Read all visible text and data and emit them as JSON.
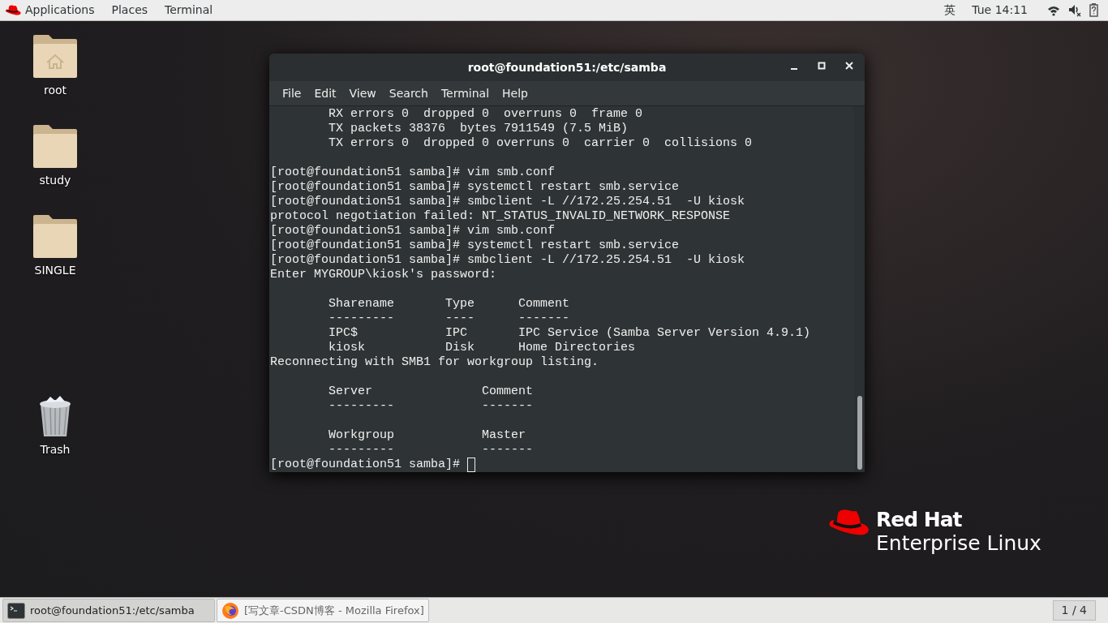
{
  "top_bar": {
    "menus": [
      "Applications",
      "Places",
      "Terminal"
    ],
    "input_method": "英",
    "clock": "Tue 14:11"
  },
  "desktop_icons": [
    {
      "label": "root",
      "kind": "home"
    },
    {
      "label": "study",
      "kind": "folder"
    },
    {
      "label": "SINGLE",
      "kind": "folder"
    },
    {
      "label": "Trash",
      "kind": "trash"
    }
  ],
  "terminal": {
    "title": "root@foundation51:/etc/samba",
    "menu": [
      "File",
      "Edit",
      "View",
      "Search",
      "Terminal",
      "Help"
    ],
    "blocks": [
      [
        "        RX errors 0  dropped 0  overruns 0  frame 0",
        "        TX packets 38376  bytes 7911549 (7.5 MiB)",
        "        TX errors 0  dropped 0 overruns 0  carrier 0  collisions 0"
      ],
      [
        "[root@foundation51 samba]# vim smb.conf",
        "[root@foundation51 samba]# systemctl restart smb.service",
        "[root@foundation51 samba]# smbclient -L //172.25.254.51  -U kiosk",
        "protocol negotiation failed: NT_STATUS_INVALID_NETWORK_RESPONSE",
        "[root@foundation51 samba]# vim smb.conf",
        "[root@foundation51 samba]# systemctl restart smb.service",
        "[root@foundation51 samba]# smbclient -L //172.25.254.51  -U kiosk",
        "Enter MYGROUP\\kiosk's password:"
      ],
      [
        "        Sharename       Type      Comment",
        "        ---------       ----      -------",
        "        IPC$            IPC       IPC Service (Samba Server Version 4.9.1)",
        "        kiosk           Disk      Home Directories",
        "Reconnecting with SMB1 for workgroup listing."
      ],
      [
        "        Server               Comment",
        "        ---------            -------"
      ],
      [
        "        Workgroup            Master",
        "        ---------            -------"
      ]
    ],
    "prompt": "[root@foundation51 samba]# "
  },
  "logo": {
    "line1": "Red Hat",
    "line2": "Enterprise Linux"
  },
  "taskbar": {
    "items": [
      {
        "label": "root@foundation51:/etc/samba",
        "kind": "terminal",
        "selected": true
      },
      {
        "label": "[写文章-CSDN博客 - Mozilla Firefox]",
        "kind": "firefox",
        "selected": false
      }
    ],
    "workspace": "1 / 4"
  }
}
